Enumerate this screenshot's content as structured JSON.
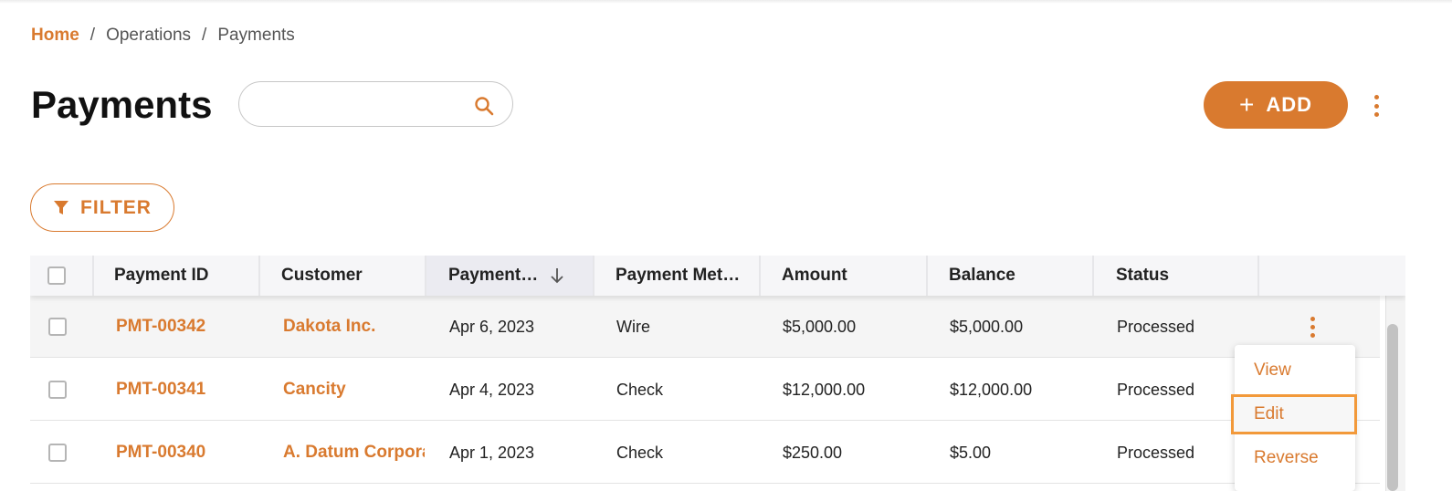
{
  "breadcrumb": {
    "home": "Home",
    "sep1": "/",
    "section": "Operations",
    "sep2": "/",
    "current": "Payments"
  },
  "page": {
    "title": "Payments"
  },
  "search": {
    "value": "",
    "placeholder": "",
    "icon": "search-icon"
  },
  "actions": {
    "add_icon": "+",
    "add_label": "ADD",
    "more_icon": "more-vertical-icon"
  },
  "filter": {
    "label": "FILTER",
    "icon": "filter-icon"
  },
  "table": {
    "columns": [
      "Payment ID",
      "Customer",
      "Payment…",
      "Payment Met…",
      "Amount",
      "Balance",
      "Status"
    ],
    "sort": {
      "column": "Payment…",
      "direction": "descending"
    },
    "rows": [
      {
        "id": "PMT-00342",
        "customer": "Dakota Inc.",
        "date": "Apr 6, 2023",
        "method": "Wire",
        "amount": "$5,000.00",
        "balance": "$5,000.00",
        "status": "Processed"
      },
      {
        "id": "PMT-00341",
        "customer": "Cancity",
        "date": "Apr 4, 2023",
        "method": "Check",
        "amount": "$12,000.00",
        "balance": "$12,000.00",
        "status": "Processed"
      },
      {
        "id": "PMT-00340",
        "customer": "A. Datum Corpora",
        "date": "Apr 1, 2023",
        "method": "Check",
        "amount": "$250.00",
        "balance": "$5.00",
        "status": "Processed"
      }
    ]
  },
  "row_menu": {
    "items": [
      "View",
      "Edit",
      "Reverse"
    ],
    "focused": "Edit"
  },
  "colors": {
    "accent": "#d97a2f",
    "focus_ring": "#f2993a"
  }
}
